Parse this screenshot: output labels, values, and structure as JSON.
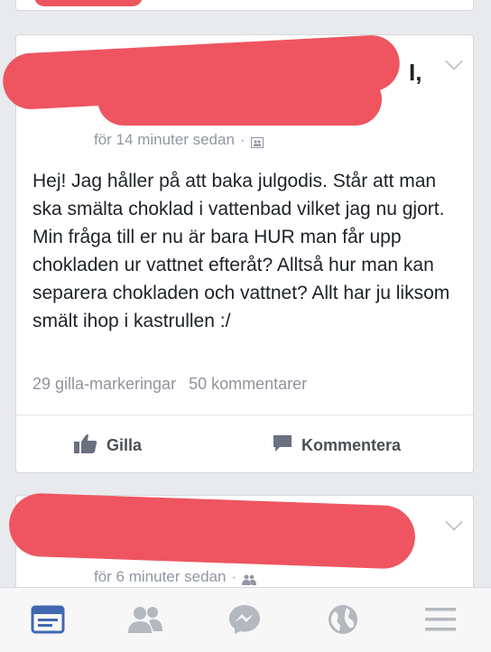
{
  "main_post": {
    "timestamp": "för 14 minuter sedan",
    "separator": "·",
    "body": "Hej! Jag håller på att baka julgodis. Står att man ska smälta choklad i vattenbad vilket jag nu gjort. Min fråga till er nu är bara HUR man får upp chokladen ur vattnet efteråt? Alltså hur man kan separera chokladen och vattnet? Allt har ju liksom smält ihop i kastrullen :/",
    "likes": "29 gilla-markeringar",
    "comments": "50 kommentarer",
    "like_label": "Gilla",
    "comment_label": "Kommentera",
    "audience_icon": "group-icon"
  },
  "next_post": {
    "timestamp": "för 6 minuter sedan",
    "separator": "·",
    "audience_icon": "friends-icon"
  },
  "nav": {
    "items": [
      "news-feed-icon",
      "friend-requests-icon",
      "messenger-icon",
      "notifications-globe-icon",
      "menu-icon"
    ],
    "active": "news-feed-icon"
  },
  "colors": {
    "background": "#e9eaed",
    "redaction": "#ee5560",
    "active_nav": "#4267b2",
    "inactive_nav": "#b4b8bf"
  }
}
